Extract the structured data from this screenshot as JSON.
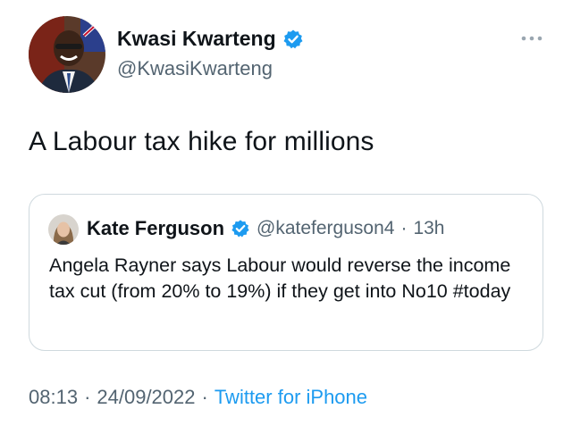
{
  "author": {
    "name": "Kwasi Kwarteng",
    "handle": "@KwasiKwarteng",
    "verified": true
  },
  "tweet": {
    "text": "A Labour tax hike for millions",
    "time": "08:13",
    "separator": "·",
    "date": "24/09/2022",
    "source": "Twitter for iPhone"
  },
  "quoted": {
    "name": "Kate Ferguson",
    "handle": "@kateferguson4",
    "separator": "·",
    "time": "13h",
    "verified": true,
    "text": "Angela Rayner says Labour would reverse the income tax cut (from 20% to 19%)  if they get into No10 #today"
  },
  "icons": {
    "more": "more-options-icon",
    "verified": "verified-badge-icon"
  },
  "colors": {
    "text_primary": "#0f1419",
    "text_secondary": "#536471",
    "link_blue": "#1d9bf0",
    "border": "#cfd9de"
  }
}
